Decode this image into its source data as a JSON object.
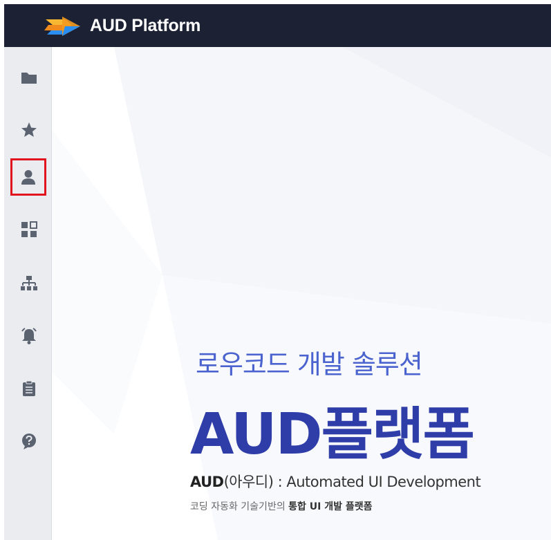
{
  "header": {
    "brand": "AUD Platform",
    "logo_icon": "aud-logo-arrow-icon"
  },
  "sidebar": {
    "items": [
      {
        "name": "folder",
        "icon": "folder-icon"
      },
      {
        "name": "favorites",
        "icon": "star-icon"
      },
      {
        "name": "user",
        "icon": "user-icon",
        "selected": true
      },
      {
        "name": "dashboard",
        "icon": "grid-icon"
      },
      {
        "name": "hierarchy",
        "icon": "sitemap-icon"
      },
      {
        "name": "notifications",
        "icon": "bell-icon"
      },
      {
        "name": "clipboard",
        "icon": "clipboard-icon"
      },
      {
        "name": "help",
        "icon": "help-icon"
      }
    ],
    "selected_outline_color": "#e0141e"
  },
  "hero": {
    "subtitle": "로우코드 개발 솔루션",
    "title": "AUD플랫폼",
    "desc_strong": "AUD",
    "desc_rest": "(아우디) : Automated UI Development",
    "tag_plain": "코딩 자동화 기술기반의 ",
    "tag_strong": "통합 UI 개발 플랫폼"
  },
  "colors": {
    "topbar": "#1c2234",
    "sidebar": "#eaecf0",
    "icon": "#5b6270",
    "accent_blue": "#4a63cf",
    "title_blue": "#2f3da8",
    "logo_orange": "#f39a1e",
    "logo_blue": "#2a8ff0"
  }
}
